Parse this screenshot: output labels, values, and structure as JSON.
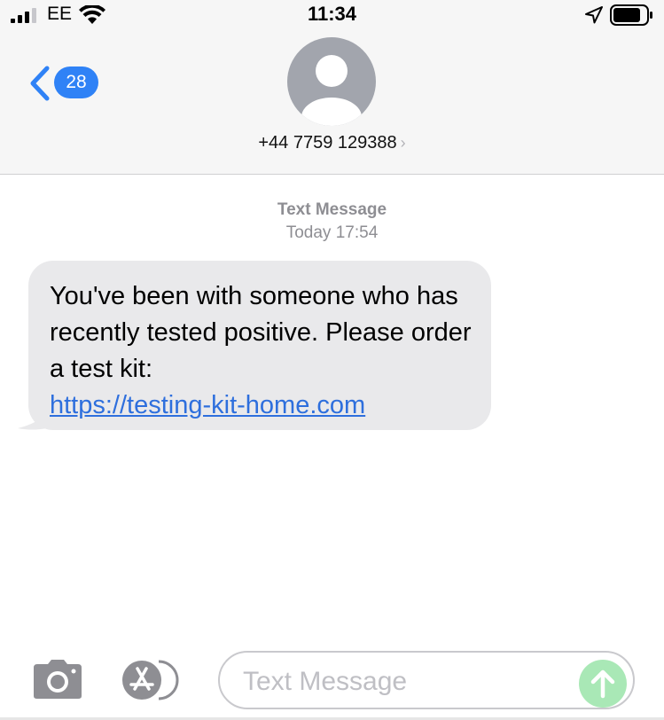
{
  "status_bar": {
    "carrier": "EE",
    "time": "11:34",
    "icons": [
      "cellular-signal-icon",
      "wifi-icon",
      "location-arrow-icon",
      "battery-icon"
    ]
  },
  "header": {
    "back_badge_count": "28",
    "contact_number": "+44 7759 129388",
    "icons": [
      "back-chevron-icon",
      "contact-avatar-icon",
      "chevron-right-icon"
    ]
  },
  "conversation": {
    "timestamp_label": "Text Message",
    "timestamp_time": "Today 17:54",
    "message": {
      "text": "You've been with someone who has recently tested positive. Please order a test kit:",
      "link": "https://testing-kit-home.com"
    }
  },
  "input_bar": {
    "placeholder": "Text Message",
    "icons": [
      "camera-icon",
      "app-store-icon",
      "send-arrow-icon"
    ]
  },
  "colors": {
    "accent_blue": "#2f82f6",
    "link_blue": "#2e6fdd",
    "bubble_gray": "#e9e9eb",
    "send_green_disabled": "#a9e8b6",
    "header_bg": "#f6f6f6"
  }
}
